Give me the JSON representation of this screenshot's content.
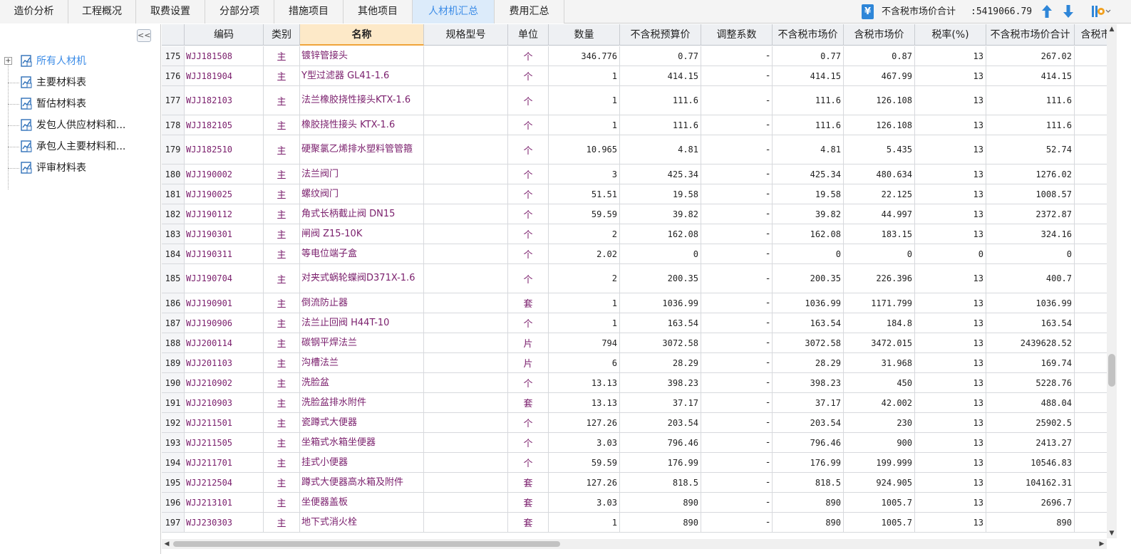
{
  "tabs": [
    {
      "label": "造价分析",
      "active": false
    },
    {
      "label": "工程概况",
      "active": false
    },
    {
      "label": "取费设置",
      "active": false
    },
    {
      "label": "分部分项",
      "active": false
    },
    {
      "label": "措施项目",
      "active": false
    },
    {
      "label": "其他项目",
      "active": false
    },
    {
      "label": "人材机汇总",
      "active": true
    },
    {
      "label": "费用汇总",
      "active": false
    }
  ],
  "toolbar": {
    "yen_icon": "yen-icon",
    "yen_glyph": "¥",
    "total_label": "不含税市场价合计",
    "total_value": ":5419066.79",
    "up_icon": "arrow-up-icon",
    "down_icon": "arrow-down-icon",
    "settings_icon": "settings-icon"
  },
  "sidebar": {
    "collapse_glyph": "<<",
    "expander_glyph": "+",
    "items": [
      {
        "label": "所有人材机",
        "selected": true
      },
      {
        "label": "主要材料表",
        "selected": false
      },
      {
        "label": "暂估材料表",
        "selected": false
      },
      {
        "label": "发包人供应材料和...",
        "selected": false
      },
      {
        "label": "承包人主要材料和...",
        "selected": false
      },
      {
        "label": "评审材料表",
        "selected": false
      }
    ]
  },
  "grid": {
    "columns": [
      "",
      "编码",
      "类别",
      "名称",
      "规格型号",
      "单位",
      "数量",
      "不含税预算价",
      "调整系数",
      "不含税市场价",
      "含税市场价",
      "税率(%)",
      "不含税市场价合计",
      "含税市"
    ],
    "sorted_column": "名称",
    "rows": [
      {
        "idx": "175",
        "code": "WJJ181508",
        "type": "主",
        "name": [
          "镀锌管接头"
        ],
        "spec": "",
        "unit": "个",
        "qty": "346.776",
        "budget": "0.77",
        "factor": "-",
        "market": "0.77",
        "market_tax": "0.87",
        "rate": "13",
        "total": "267.02",
        "total_tax": ""
      },
      {
        "idx": "176",
        "code": "WJJ181904",
        "type": "主",
        "name": [
          "Y型过滤器 GL41-1.6"
        ],
        "spec": "",
        "unit": "个",
        "qty": "1",
        "budget": "414.15",
        "factor": "-",
        "market": "414.15",
        "market_tax": "467.99",
        "rate": "13",
        "total": "414.15",
        "total_tax": ""
      },
      {
        "idx": "177",
        "code": "WJJ182103",
        "type": "主",
        "name": [
          "法兰橡胶挠性接头",
          "KTX-1.6"
        ],
        "spec": "",
        "unit": "个",
        "qty": "1",
        "budget": "111.6",
        "factor": "-",
        "market": "111.6",
        "market_tax": "126.108",
        "rate": "13",
        "total": "111.6",
        "total_tax": ""
      },
      {
        "idx": "178",
        "code": "WJJ182105",
        "type": "主",
        "name": [
          "橡胶挠性接头 KTX-1.6"
        ],
        "spec": "",
        "unit": "个",
        "qty": "1",
        "budget": "111.6",
        "factor": "-",
        "market": "111.6",
        "market_tax": "126.108",
        "rate": "13",
        "total": "111.6",
        "total_tax": ""
      },
      {
        "idx": "179",
        "code": "WJJ182510",
        "type": "主",
        "name": [
          "硬聚氯乙烯排水塑料管管",
          "箍"
        ],
        "spec": "",
        "unit": "个",
        "qty": "10.965",
        "budget": "4.81",
        "factor": "-",
        "market": "4.81",
        "market_tax": "5.435",
        "rate": "13",
        "total": "52.74",
        "total_tax": ""
      },
      {
        "idx": "180",
        "code": "WJJ190002",
        "type": "主",
        "name": [
          "法兰阀门"
        ],
        "spec": "",
        "unit": "个",
        "qty": "3",
        "budget": "425.34",
        "factor": "-",
        "market": "425.34",
        "market_tax": "480.634",
        "rate": "13",
        "total": "1276.02",
        "total_tax": ""
      },
      {
        "idx": "181",
        "code": "WJJ190025",
        "type": "主",
        "name": [
          "螺纹阀门"
        ],
        "spec": "",
        "unit": "个",
        "qty": "51.51",
        "budget": "19.58",
        "factor": "-",
        "market": "19.58",
        "market_tax": "22.125",
        "rate": "13",
        "total": "1008.57",
        "total_tax": ""
      },
      {
        "idx": "182",
        "code": "WJJ190112",
        "type": "主",
        "name": [
          "角式长柄截止阀 DN15"
        ],
        "spec": "",
        "unit": "个",
        "qty": "59.59",
        "budget": "39.82",
        "factor": "-",
        "market": "39.82",
        "market_tax": "44.997",
        "rate": "13",
        "total": "2372.87",
        "total_tax": ""
      },
      {
        "idx": "183",
        "code": "WJJ190301",
        "type": "主",
        "name": [
          "闸阀 Z15-10K"
        ],
        "spec": "",
        "unit": "个",
        "qty": "2",
        "budget": "162.08",
        "factor": "-",
        "market": "162.08",
        "market_tax": "183.15",
        "rate": "13",
        "total": "324.16",
        "total_tax": ""
      },
      {
        "idx": "184",
        "code": "WJJ190311",
        "type": "主",
        "name": [
          "等电位端子盒"
        ],
        "spec": "",
        "unit": "个",
        "qty": "2.02",
        "budget": "0",
        "factor": "-",
        "market": "0",
        "market_tax": "0",
        "rate": "0",
        "total": "0",
        "total_tax": ""
      },
      {
        "idx": "185",
        "code": "WJJ190704",
        "type": "主",
        "name": [
          "对夹式蜗轮蝶阀",
          "D371X-1.6"
        ],
        "spec": "",
        "unit": "个",
        "qty": "2",
        "budget": "200.35",
        "factor": "-",
        "market": "200.35",
        "market_tax": "226.396",
        "rate": "13",
        "total": "400.7",
        "total_tax": ""
      },
      {
        "idx": "186",
        "code": "WJJ190901",
        "type": "主",
        "name": [
          "倒流防止器"
        ],
        "spec": "",
        "unit": "套",
        "qty": "1",
        "budget": "1036.99",
        "factor": "-",
        "market": "1036.99",
        "market_tax": "1171.799",
        "rate": "13",
        "total": "1036.99",
        "total_tax": ""
      },
      {
        "idx": "187",
        "code": "WJJ190906",
        "type": "主",
        "name": [
          "法兰止回阀 H44T-10"
        ],
        "spec": "",
        "unit": "个",
        "qty": "1",
        "budget": "163.54",
        "factor": "-",
        "market": "163.54",
        "market_tax": "184.8",
        "rate": "13",
        "total": "163.54",
        "total_tax": ""
      },
      {
        "idx": "188",
        "code": "WJJ200114",
        "type": "主",
        "name": [
          "碳钢平焊法兰"
        ],
        "spec": "",
        "unit": "片",
        "qty": "794",
        "budget": "3072.58",
        "factor": "-",
        "market": "3072.58",
        "market_tax": "3472.015",
        "rate": "13",
        "total": "2439628.52",
        "total_tax": "2"
      },
      {
        "idx": "189",
        "code": "WJJ201103",
        "type": "主",
        "name": [
          "沟槽法兰"
        ],
        "spec": "",
        "unit": "片",
        "qty": "6",
        "budget": "28.29",
        "factor": "-",
        "market": "28.29",
        "market_tax": "31.968",
        "rate": "13",
        "total": "169.74",
        "total_tax": ""
      },
      {
        "idx": "190",
        "code": "WJJ210902",
        "type": "主",
        "name": [
          "洗脸盆"
        ],
        "spec": "",
        "unit": "个",
        "qty": "13.13",
        "budget": "398.23",
        "factor": "-",
        "market": "398.23",
        "market_tax": "450",
        "rate": "13",
        "total": "5228.76",
        "total_tax": ""
      },
      {
        "idx": "191",
        "code": "WJJ210903",
        "type": "主",
        "name": [
          "洗脸盆排水附件"
        ],
        "spec": "",
        "unit": "套",
        "qty": "13.13",
        "budget": "37.17",
        "factor": "-",
        "market": "37.17",
        "market_tax": "42.002",
        "rate": "13",
        "total": "488.04",
        "total_tax": ""
      },
      {
        "idx": "192",
        "code": "WJJ211501",
        "type": "主",
        "name": [
          "瓷蹲式大便器"
        ],
        "spec": "",
        "unit": "个",
        "qty": "127.26",
        "budget": "203.54",
        "factor": "-",
        "market": "203.54",
        "market_tax": "230",
        "rate": "13",
        "total": "25902.5",
        "total_tax": ""
      },
      {
        "idx": "193",
        "code": "WJJ211505",
        "type": "主",
        "name": [
          "坐箱式水箱坐便器"
        ],
        "spec": "",
        "unit": "个",
        "qty": "3.03",
        "budget": "796.46",
        "factor": "-",
        "market": "796.46",
        "market_tax": "900",
        "rate": "13",
        "total": "2413.27",
        "total_tax": ""
      },
      {
        "idx": "194",
        "code": "WJJ211701",
        "type": "主",
        "name": [
          "挂式小便器"
        ],
        "spec": "",
        "unit": "个",
        "qty": "59.59",
        "budget": "176.99",
        "factor": "-",
        "market": "176.99",
        "market_tax": "199.999",
        "rate": "13",
        "total": "10546.83",
        "total_tax": ""
      },
      {
        "idx": "195",
        "code": "WJJ212504",
        "type": "主",
        "name": [
          "蹲式大便器高水箱及附件"
        ],
        "spec": "",
        "unit": "套",
        "qty": "127.26",
        "budget": "818.5",
        "factor": "-",
        "market": "818.5",
        "market_tax": "924.905",
        "rate": "13",
        "total": "104162.31",
        "total_tax": ""
      },
      {
        "idx": "196",
        "code": "WJJ213101",
        "type": "主",
        "name": [
          "坐便器盖板"
        ],
        "spec": "",
        "unit": "套",
        "qty": "3.03",
        "budget": "890",
        "factor": "-",
        "market": "890",
        "market_tax": "1005.7",
        "rate": "13",
        "total": "2696.7",
        "total_tax": ""
      },
      {
        "idx": "197",
        "code": "WJJ230303",
        "type": "主",
        "name": [
          "地下式消火栓"
        ],
        "spec": "",
        "unit": "套",
        "qty": "1",
        "budget": "890",
        "factor": "-",
        "market": "890",
        "market_tax": "1005.7",
        "rate": "13",
        "total": "890",
        "total_tax": ""
      }
    ]
  },
  "scrollbars": {
    "up_glyph": "▲",
    "down_glyph": "▼",
    "left_glyph": "◀",
    "right_glyph": "▶"
  }
}
